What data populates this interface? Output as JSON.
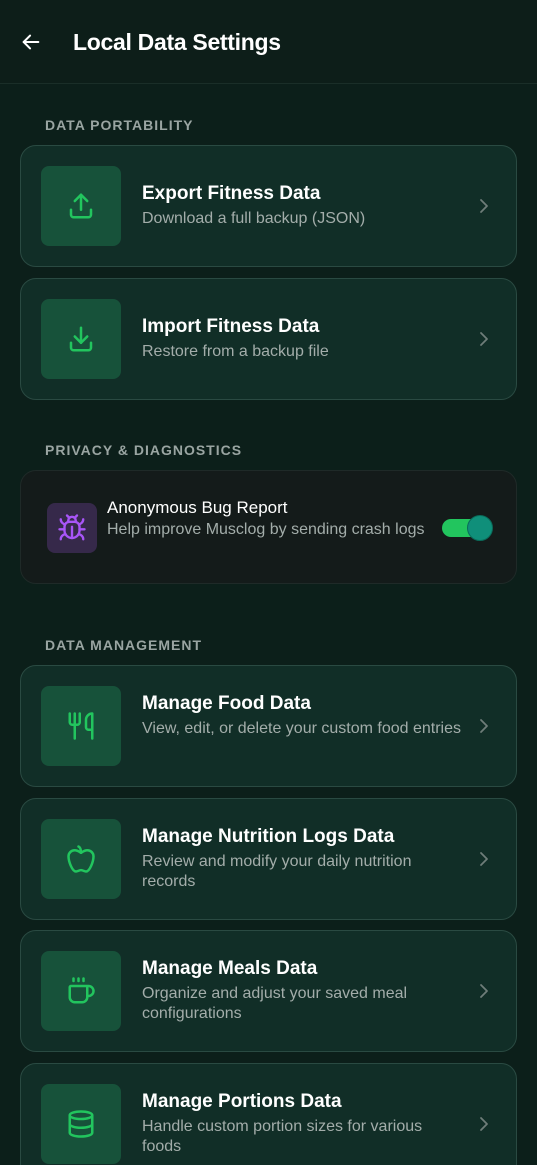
{
  "header": {
    "title": "Local Data Settings",
    "back_icon": "arrow-left-icon"
  },
  "sections": {
    "portability": "DATA PORTABILITY",
    "privacy": "PRIVACY & DIAGNOSTICS",
    "management": "DATA MANAGEMENT"
  },
  "portability_items": [
    {
      "title": "Export Fitness Data",
      "desc": "Download a full backup (JSON)",
      "icon": "upload-icon"
    },
    {
      "title": "Import Fitness Data",
      "desc": "Restore from a backup file",
      "icon": "download-icon"
    }
  ],
  "privacy": {
    "title": "Anonymous Bug Report",
    "desc": "Help improve Musclog by sending crash logs",
    "icon": "bug-icon",
    "enabled": true
  },
  "management_items": [
    {
      "title": "Manage Food Data",
      "desc": "View, edit, or delete your custom food entries",
      "icon": "utensils-icon"
    },
    {
      "title": "Manage Nutrition Logs Data",
      "desc": "Review and modify your daily nutrition records",
      "icon": "apple-icon"
    },
    {
      "title": "Manage Meals Data",
      "desc": "Organize and adjust your saved meal configurations",
      "icon": "coffee-icon"
    },
    {
      "title": "Manage Portions Data",
      "desc": "Handle custom portion sizes for various foods",
      "icon": "database-icon"
    }
  ],
  "colors": {
    "accent": "#22c55e",
    "background": "#0c1f1a",
    "card": "#112e27",
    "icon_box": "#17523a",
    "bug_icon_box": "#36294a",
    "bug_icon": "#a855f7"
  }
}
